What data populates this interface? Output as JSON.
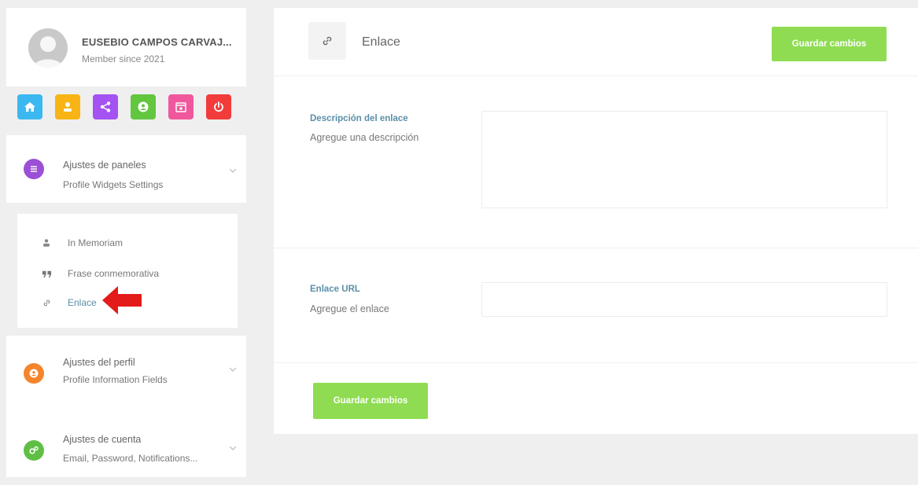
{
  "user": {
    "name": "EUSEBIO CAMPOS CARVAJ...",
    "since": "Member since 2021"
  },
  "nav_icons": [
    {
      "name": "home-icon",
      "color": "#3bb8f0"
    },
    {
      "name": "user-icon",
      "color": "#f7b414"
    },
    {
      "name": "share-icon",
      "color": "#a452f2"
    },
    {
      "name": "profile-icon",
      "color": "#62c63e"
    },
    {
      "name": "calendar-icon",
      "color": "#f0579c"
    },
    {
      "name": "power-icon",
      "color": "#f23b3b"
    }
  ],
  "groups": {
    "panels": {
      "title": "Ajustes de paneles",
      "subtitle": "Profile Widgets Settings",
      "color": "#9b4fd6"
    },
    "profile": {
      "title": "Ajustes del perfil",
      "subtitle": "Profile Information Fields",
      "color": "#f5842b"
    },
    "account": {
      "title": "Ajustes de cuenta",
      "subtitle": "Email, Password, Notifications...",
      "color": "#5fbf45"
    }
  },
  "submenu": {
    "items": [
      {
        "label": "In Memoriam",
        "icon": "person-icon"
      },
      {
        "label": "Frase conmemorativa",
        "icon": "quote-icon"
      },
      {
        "label": "Enlace",
        "icon": "link-icon",
        "active": true
      }
    ]
  },
  "main": {
    "title": "Enlace",
    "save_label": "Guardar cambios",
    "fields": [
      {
        "label": "Descripción del enlace",
        "hint": "Agregue una descripción",
        "value": ""
      },
      {
        "label": "Enlace URL",
        "hint": "Agregue el enlace",
        "value": ""
      }
    ]
  },
  "colors": {
    "accent": "#8fdc52",
    "label": "#5b8fa8",
    "arrow": "#e41b1b"
  }
}
